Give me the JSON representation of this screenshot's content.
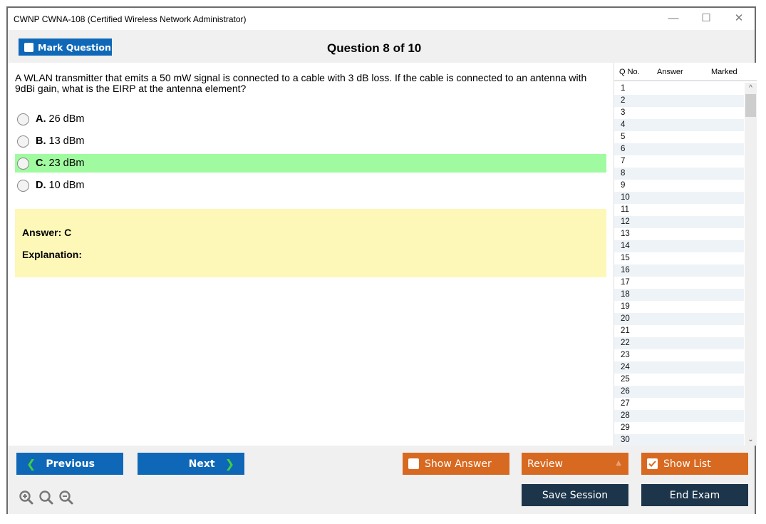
{
  "window": {
    "title": "CWNP CWNA-108 (Certified Wireless Network Administrator)",
    "controls": {
      "minimize": "—",
      "maximize": "☐",
      "close": "✕"
    }
  },
  "toolbar": {
    "mark_question_label": "Mark Question",
    "mark_question_checked": false,
    "question_counter": "Question 8 of 10"
  },
  "question": {
    "text": "A WLAN transmitter that emits a 50 mW signal is connected to a cable with 3 dB loss. If the cable is connected to an antenna with 9dBi gain, what is the EIRP at the antenna element?",
    "options": [
      {
        "letter": "A.",
        "text": "26 dBm",
        "correct": false
      },
      {
        "letter": "B.",
        "text": "13 dBm",
        "correct": false
      },
      {
        "letter": "C.",
        "text": "23 dBm",
        "correct": true
      },
      {
        "letter": "D.",
        "text": "10 dBm",
        "correct": false
      }
    ],
    "answer_label": "Answer: C",
    "explanation_label": "Explanation:"
  },
  "question_list": {
    "headers": {
      "qno": "Q No.",
      "answer": "Answer",
      "marked": "Marked"
    },
    "rows": [
      "1",
      "2",
      "3",
      "4",
      "5",
      "6",
      "7",
      "8",
      "9",
      "10",
      "11",
      "12",
      "13",
      "14",
      "15",
      "16",
      "17",
      "18",
      "19",
      "20",
      "21",
      "22",
      "23",
      "24",
      "25",
      "26",
      "27",
      "28",
      "29",
      "30"
    ]
  },
  "bottom": {
    "previous_label": "Previous",
    "next_label": "Next",
    "show_answer_label": "Show Answer",
    "show_answer_checked": false,
    "review_label": "Review",
    "show_list_label": "Show List",
    "show_list_checked": true,
    "save_session_label": "Save Session",
    "end_exam_label": "End Exam"
  },
  "colors": {
    "primary_blue": "#0f68b7",
    "orange": "#d86920",
    "dark_navy": "#1c354b",
    "correct_green": "#a0fba0",
    "answer_yellow": "#fdf8b8"
  }
}
